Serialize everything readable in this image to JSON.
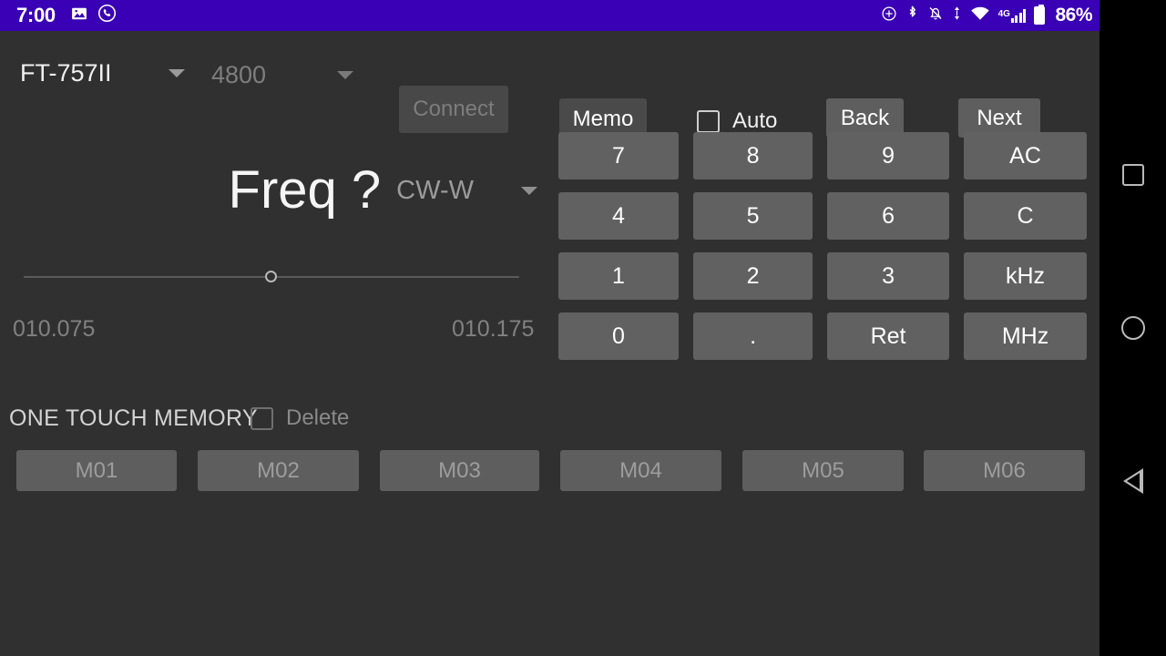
{
  "status_bar": {
    "clock": "7:00",
    "left_icons": [
      "image-icon",
      "phone-call-icon"
    ],
    "right_icons": [
      "do-not-disturb-icon",
      "bluetooth-icon",
      "alarm-off-icon",
      "data-transfer-icon",
      "wifi-icon"
    ],
    "network_label": "4G",
    "battery_percent": "86%",
    "background_color": "#3a00b5"
  },
  "toolbar": {
    "radio_model": "FT-757II",
    "baud_rate": "4800",
    "connect_label": "Connect",
    "memo_label": "Memo",
    "auto_label": "Auto",
    "auto_checked": false,
    "back_label": "Back",
    "next_label": "Next"
  },
  "display": {
    "frequency": "Freq ?",
    "mode": "CW-W"
  },
  "slider": {
    "min_label": "010.075",
    "max_label": "010.175",
    "position_percent": 50
  },
  "memory": {
    "section_label": "ONE TOUCH MEMORY",
    "delete_label": "Delete",
    "delete_checked": false,
    "buttons": [
      {
        "label": "M01"
      },
      {
        "label": "M02"
      },
      {
        "label": "M03"
      },
      {
        "label": "M04"
      },
      {
        "label": "M05"
      },
      {
        "label": "M06"
      }
    ]
  },
  "keypad": {
    "rows": [
      [
        {
          "label": "7"
        },
        {
          "label": "8"
        },
        {
          "label": "9"
        },
        {
          "label": "AC"
        }
      ],
      [
        {
          "label": "4"
        },
        {
          "label": "5"
        },
        {
          "label": "6"
        },
        {
          "label": "C"
        }
      ],
      [
        {
          "label": "1"
        },
        {
          "label": "2"
        },
        {
          "label": "3"
        },
        {
          "label": "kHz"
        }
      ],
      [
        {
          "label": "0"
        },
        {
          "label": "."
        },
        {
          "label": "Ret"
        },
        {
          "label": "MHz"
        }
      ]
    ]
  },
  "nav_bar": {
    "recents": "recents-square-icon",
    "home": "home-circle-icon",
    "back": "back-triangle-icon"
  },
  "colors": {
    "background": "#303030",
    "button_fill": "#616161",
    "accent_purple": "#3a00b5"
  }
}
